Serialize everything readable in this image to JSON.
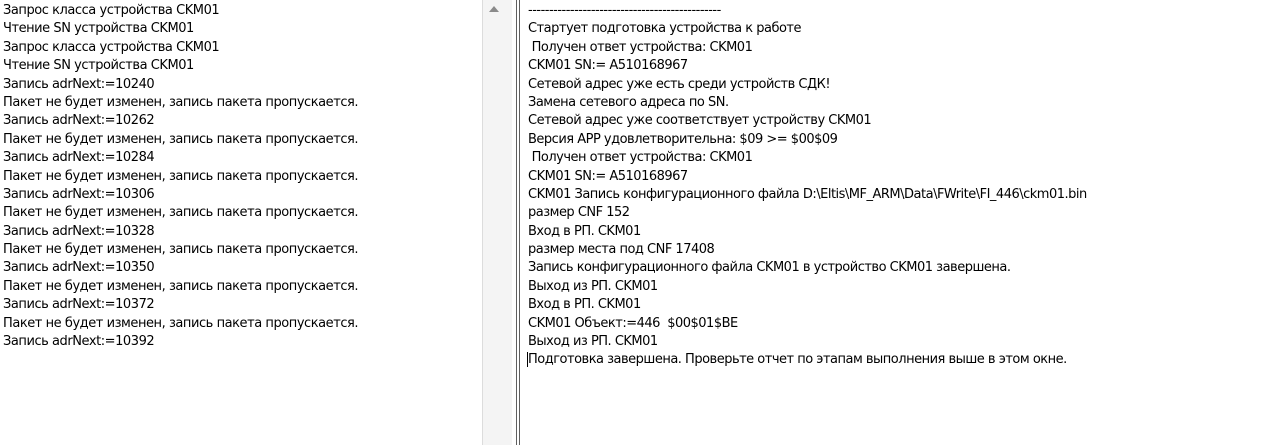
{
  "left_log": {
    "lines": [
      "Запрос класса устройства CKM01",
      "Чтение SN устройства CKM01",
      "Запрос класса устройства CKM01",
      "Чтение SN устройства CKM01",
      "Запись adrNext:=10240",
      "Пакет не будет изменен, запись пакета пропускается.",
      "Запись adrNext:=10262",
      "Пакет не будет изменен, запись пакета пропускается.",
      "Запись adrNext:=10284",
      "Пакет не будет изменен, запись пакета пропускается.",
      "Запись adrNext:=10306",
      "Пакет не будет изменен, запись пакета пропускается.",
      "Запись adrNext:=10328",
      "Пакет не будет изменен, запись пакета пропускается.",
      "Запись adrNext:=10350",
      "Пакет не будет изменен, запись пакета пропускается.",
      "Запись adrNext:=10372",
      "Пакет не будет изменен, запись пакета пропускается.",
      "Запись adrNext:=10392"
    ]
  },
  "right_log": {
    "lines": [
      "----------------------------------------------",
      "Стартует подготовка устройства к работе",
      " Получен ответ устройства: CKM01",
      "CKM01 SN:= A510168967",
      "Сетевой адрес уже есть среди устройств СДК!",
      "Замена сетевого адреса по SN.",
      "Сетевой адрес уже соответствует устройству CKM01",
      "Версия APP удовлетворительна: $09 >= $00$09",
      " Получен ответ устройства: CKM01",
      "CKM01 SN:= A510168967",
      "CKM01 Запись конфигурационного файла D:\\Eltis\\MF_ARM\\Data\\FWrite\\FI_446\\ckm01.bin",
      "размер CNF 152",
      "Вход в РП. CKM01",
      "размер места под CNF 17408",
      "Запись конфигурационного файла CKM01 в устройство CKM01 завершена.",
      "Выход из РП. CKM01",
      "Вход в РП. CKM01",
      "CKM01 Объект:=446  $00$01$BE",
      "Выход из РП. CKM01",
      "Подготовка завершена. Проверьте отчет по этапам выполнения выше в этом окне."
    ]
  },
  "icons": {
    "scroll_up": "scroll-up-arrow-icon"
  },
  "colors": {
    "background": "#ffffff",
    "text": "#000000",
    "splitter": "#606060"
  }
}
